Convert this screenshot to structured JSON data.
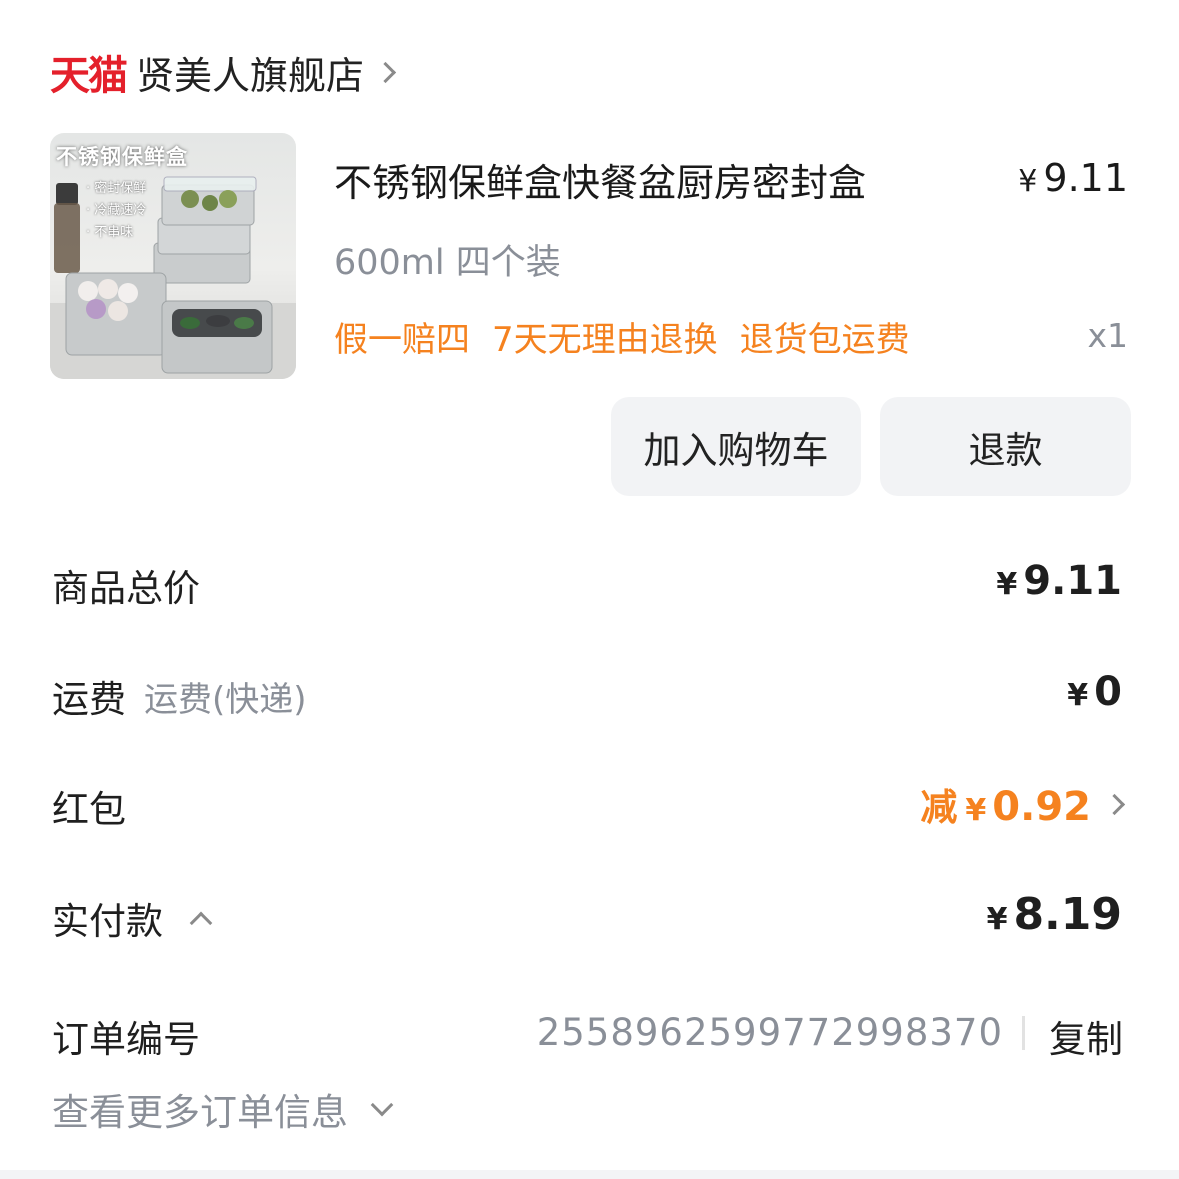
{
  "store": {
    "platform_logo": "天猫",
    "name": "贤美人旗舰店"
  },
  "product": {
    "thumbnail": {
      "title": "不锈钢保鲜盒",
      "features": [
        "· 密封保鲜",
        "· 冷藏速冷",
        "· 不串味"
      ]
    },
    "title": "不锈钢保鲜盒快餐盆厨房密封盒",
    "price_symbol": "¥",
    "price": "9.11",
    "spec": "600ml 四个装",
    "tags": [
      "假一赔四",
      "7天无理由退换",
      "退货包运费"
    ],
    "quantity": "x1",
    "actions": {
      "add_to_cart": "加入购物车",
      "refund": "退款"
    }
  },
  "summary": {
    "goods_total": {
      "label": "商品总价",
      "symbol": "¥",
      "value": "9.11"
    },
    "shipping": {
      "label": "运费",
      "sub": "运费(快递)",
      "symbol": "¥",
      "value": "0"
    },
    "red_packet": {
      "label": "红包",
      "prefix": "减",
      "symbol": "¥",
      "value": "0.92"
    },
    "paid": {
      "label": "实付款",
      "symbol": "¥",
      "value": "8.19"
    }
  },
  "order": {
    "label": "订单编号",
    "number": "2558962599772998370",
    "copy_label": "复制",
    "more_info": "查看更多订单信息"
  },
  "colors": {
    "tmall_red": "#e4202b",
    "accent_orange": "#f5821f",
    "secondary_text": "#8a8f98",
    "button_bg": "#f2f3f5"
  }
}
